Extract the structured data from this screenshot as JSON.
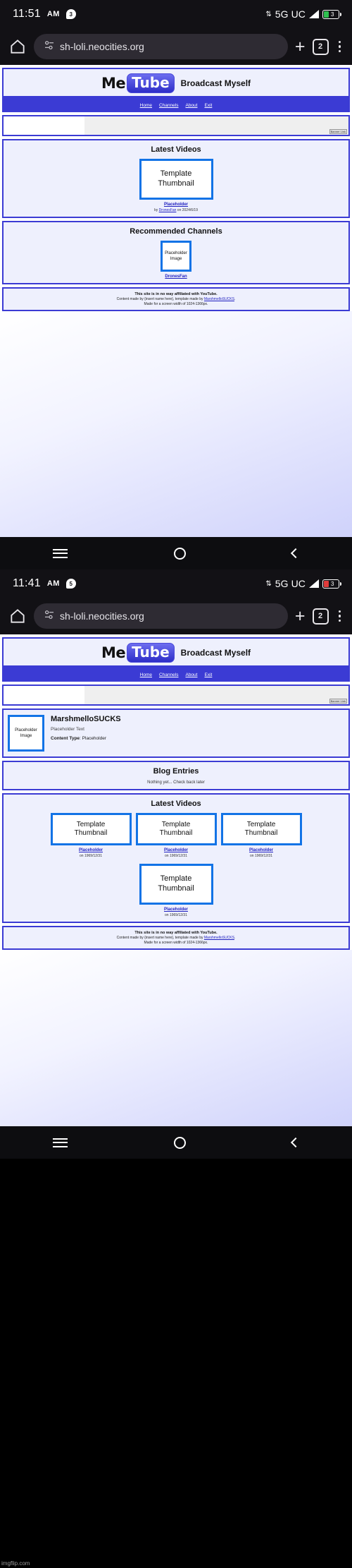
{
  "shot1": {
    "status": {
      "time": "11:51",
      "ampm": "AM",
      "notif_count": "3",
      "network": "5G UC",
      "battery_num": "3"
    },
    "toolbar": {
      "url": "sh-loli.neocities.org",
      "tab_count": "2",
      "home_icon": "home-icon",
      "new_tab_icon": "plus-icon",
      "menu_icon": "overflow-menu-icon"
    },
    "site": {
      "logo_me": "Me",
      "logo_tube": "Tube",
      "slogan": "Broadcast Myself",
      "nav": [
        "Home",
        "Channels",
        "About",
        "Exit"
      ],
      "banner_label": "Banner Link",
      "latest_title": "Latest Videos",
      "videos": [
        {
          "thumb": "Template\nThumbnail",
          "title": "Placeholder",
          "by_prefix": "by ",
          "author": "DronesFan",
          "date_prefix": " on ",
          "date": "2024/6/19"
        }
      ],
      "channels_title": "Recommended Channels",
      "channels": [
        {
          "image": "Placeholder\nImage",
          "name": "DronesFan"
        }
      ],
      "footer": {
        "line1": "This site is in no way affiliated with YouTube.",
        "line2_a": "Content made by {insert name here}, template made by ",
        "line2_link": "MarshmelloSUCKS",
        "line2_b": ".",
        "line3": "Made for a screen width of 1024-1366px."
      }
    }
  },
  "gesture1": {
    "menu": "recents-icon",
    "home": "home-circle-icon",
    "back": "back-chevron-icon"
  },
  "shot2": {
    "status": {
      "time": "11:41",
      "ampm": "AM",
      "notif_count": "5",
      "network": "5G UC",
      "battery_num": "3"
    },
    "toolbar": {
      "url": "sh-loli.neocities.org",
      "tab_count": "2",
      "home_icon": "home-icon",
      "new_tab_icon": "plus-icon",
      "menu_icon": "overflow-menu-icon"
    },
    "site": {
      "logo_me": "Me",
      "logo_tube": "Tube",
      "slogan": "Broadcast Myself",
      "nav": [
        "Home",
        "Channels",
        "About",
        "Exit"
      ],
      "banner_label": "Banner Link",
      "profile": {
        "image": "Placeholder\nImage",
        "name": "MarshmelloSUCKS",
        "desc": "Placeholder Text",
        "content_type_label": "Content Type",
        "content_type_value": "Placeholder"
      },
      "blog_title": "Blog Entries",
      "blog_note": "Nothing yet... Check back later",
      "latest_title": "Latest Videos",
      "videos": [
        {
          "thumb": "Template\nThumbnail",
          "title": "Placeholder",
          "by_prefix": "on ",
          "date": "1969/12/31"
        },
        {
          "thumb": "Template\nThumbnail",
          "title": "Placeholder",
          "by_prefix": "on ",
          "date": "1969/12/31"
        },
        {
          "thumb": "Template\nThumbnail",
          "title": "Placeholder",
          "by_prefix": "on ",
          "date": "1969/12/31"
        },
        {
          "thumb": "Template\nThumbnail",
          "title": "Placeholder",
          "by_prefix": "on ",
          "date": "1969/12/31"
        }
      ],
      "footer": {
        "line1": "This site is in no way affiliated with YouTube.",
        "line2_a": "Content made by {insert name here}, template made by ",
        "line2_link": "MarshmelloSUCKS",
        "line2_b": ".",
        "line3": "Made for a screen width of 1024-1366px."
      }
    }
  },
  "gesture2": {
    "menu": "recents-icon",
    "home": "home-circle-icon",
    "back": "back-chevron-icon"
  },
  "watermark": "imgflip.com",
  "colors": {
    "accent": "#3b3bd4",
    "thumb_border": "#1273e6",
    "link": "#2020c0",
    "panel_bg": "#eef0fd"
  }
}
